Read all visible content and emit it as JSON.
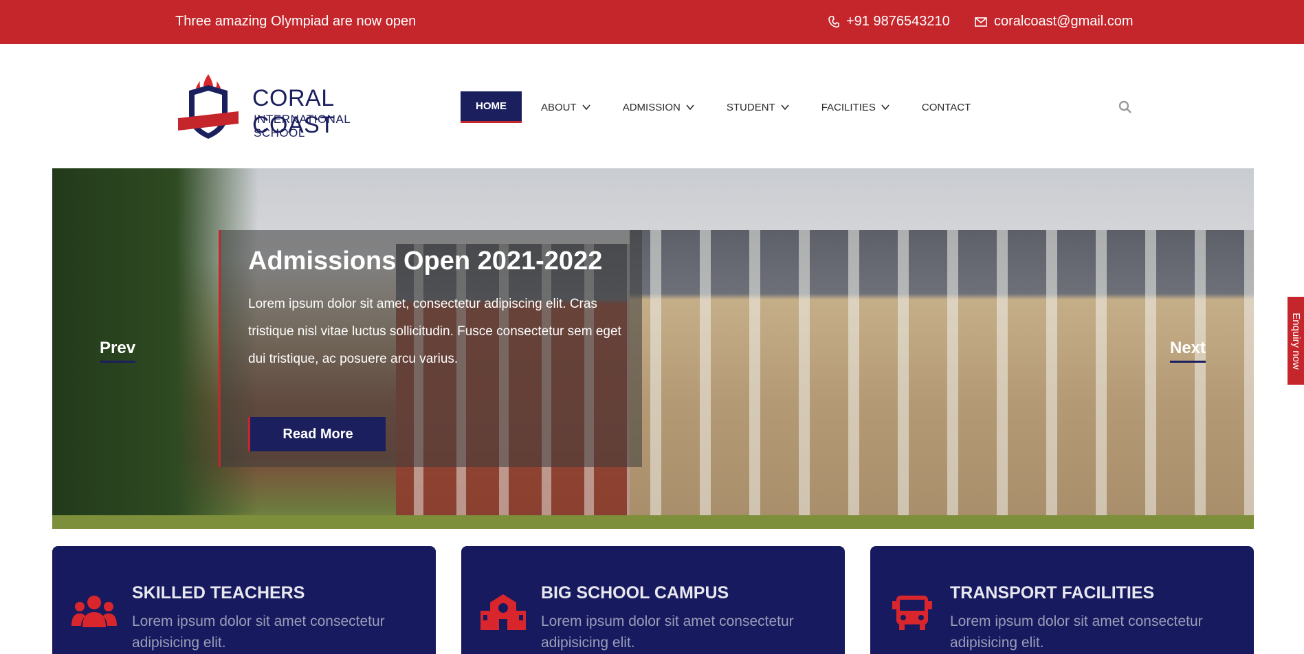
{
  "topbar": {
    "notice": "Three amazing Olympiad are now open",
    "phone": "+91 9876543210",
    "email": "coralcoast@gmail.com",
    "phone_icon": "phone-icon",
    "email_icon": "envelope-icon"
  },
  "logo": {
    "line1": "CORAL COAST",
    "line2": "INTERNATIONAL SCHOOL",
    "crest_text": "CORAL COAST"
  },
  "nav": {
    "items": [
      {
        "label": "HOME",
        "active": true
      },
      {
        "label": "ABOUT",
        "dropdown": true
      },
      {
        "label": "ADMISSION",
        "dropdown": true
      },
      {
        "label": "STUDENT",
        "dropdown": true
      },
      {
        "label": "FACILITIES",
        "dropdown": true
      },
      {
        "label": "CONTACT"
      }
    ],
    "search_icon": "search-icon"
  },
  "hero": {
    "title": "Admissions Open 2021-2022",
    "text": "Lorem ipsum dolor sit amet, consectetur adipiscing elit. Cras tristique nisl vitae luctus sollicitudin. Fusce consectetur sem eget dui tristique, ac posuere arcu varius.",
    "button": "Read More",
    "prev": "Prev",
    "next": "Next"
  },
  "enquiry": "Enquiry now",
  "features": [
    {
      "title": "SKILLED TEACHERS",
      "text": "Lorem ipsum dolor sit amet consectetur adipisicing elit.",
      "icon": "users-icon"
    },
    {
      "title": "BIG SCHOOL CAMPUS",
      "text": "Lorem ipsum dolor sit amet consectetur adipisicing elit.",
      "icon": "school-icon"
    },
    {
      "title": "TRANSPORT FACILITIES",
      "text": "Lorem ipsum dolor sit amet consectetur adipisicing elit.",
      "icon": "bus-icon"
    }
  ],
  "colors": {
    "brand_red": "#c5262c",
    "brand_navy": "#1b1f5e",
    "feature_bg": "#171a5e"
  }
}
